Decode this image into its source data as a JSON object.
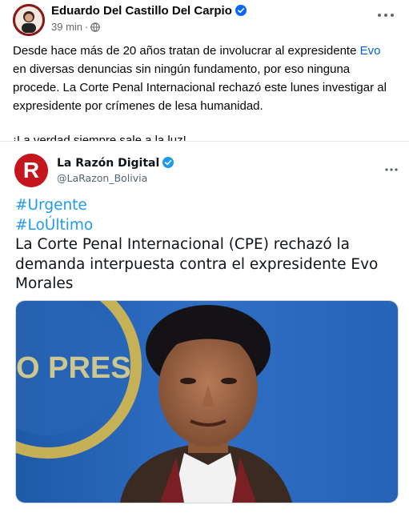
{
  "post": {
    "author": "Eduardo Del Castillo Del Carpio",
    "time": "39 min",
    "dot": "·",
    "text_part1": "Desde hace más de 20 años tratan de involucrar al expresidente ",
    "text_link": "Evo",
    "text_part2": " en diversas denuncias sin ningún fundamento, por eso ninguna procede. La Corte Penal Internacional rechazó este lunes investigar al expresidente por crímenes de lesa humanidad.",
    "text_second": "¡La verdad siempre sale a la luz!"
  },
  "tweet": {
    "name": "La Razón Digital",
    "handle": "@LaRazon_Bolivia",
    "hashtag1": "#Urgente",
    "hashtag2": "#LoÚltimo",
    "headline": "La Corte Penal Internacional (CPE) rechazó la demanda interpuesta contra el expresidente Evo Morales",
    "avatar_letter": "R",
    "image_sign_text": "O PRES"
  },
  "icons": {
    "verified": "verified-badge-icon",
    "globe": "globe-icon",
    "more": "more-options-icon"
  },
  "colors": {
    "link": "#0064d1",
    "hashtag": "#1d9bf0",
    "verified": "#0866ff",
    "brand_red": "#c4161c"
  }
}
